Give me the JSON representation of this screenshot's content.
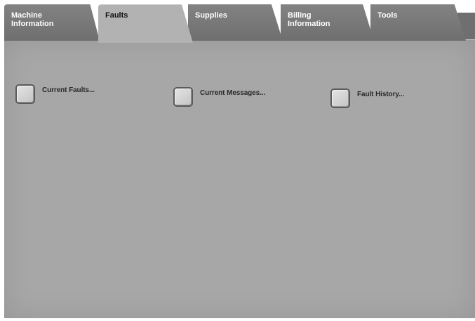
{
  "tabs": [
    {
      "label": "Machine\nInformation",
      "active": false
    },
    {
      "label": "Faults",
      "active": true
    },
    {
      "label": "Supplies",
      "active": false
    },
    {
      "label": "Billing\nInformation",
      "active": false
    },
    {
      "label": "Tools",
      "active": false
    }
  ],
  "options": {
    "current_faults": "Current Faults...",
    "current_messages": "Current Messages...",
    "fault_history": "Fault History..."
  },
  "colors": {
    "panel": "#a7a7a7",
    "tab_inactive": "#7a7a7a",
    "tab_active": "#b2b2b2"
  }
}
